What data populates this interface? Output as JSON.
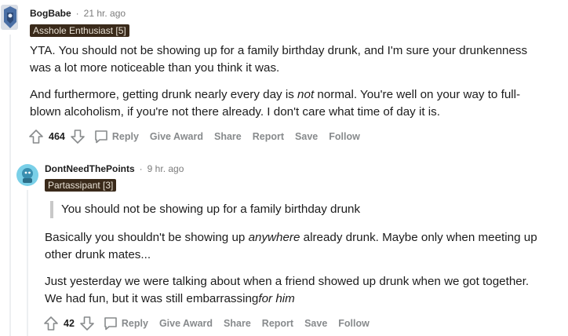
{
  "comments": [
    {
      "username": "BogBabe",
      "dot": "·",
      "time": "21 hr. ago",
      "flair": "Asshole Enthusiast [5]",
      "paragraphs": [
        "YTA. You should not be showing up for a family birthday drunk, and I'm sure your drunkenness",
        "was a lot more noticeable than you think it was."
      ],
      "p2_a": "And furthermore, getting drunk nearly every day is ",
      "p2_em": "not",
      "p2_b": " normal. You're well on your way to full-",
      "p2_line2": "blown alcoholism, if you're not there already. I don't care what time of day it is.",
      "votes": "464",
      "actions": {
        "reply": "Reply",
        "award": "Give Award",
        "share": "Share",
        "report": "Report",
        "save": "Save",
        "follow": "Follow"
      }
    },
    {
      "username": "DontNeedThePoints",
      "dot": "·",
      "time": "9 hr. ago",
      "flair": "Partassipant [3]",
      "quote": "You should not be showing up for a family birthday drunk",
      "p1_a": "Basically you shouldn't be showing up ",
      "p1_em": "anywhere",
      "p1_b": " already drunk. Maybe only when meeting up",
      "p1_line2": "other drunk mates...",
      "p2_line1": "Just yesterday we were talking about when a friend showed up drunk when we got together.",
      "p2_a": "We had fun, but it was still embarrassing",
      "p2_em": "for him",
      "votes": "42",
      "actions": {
        "reply": "Reply",
        "award": "Give Award",
        "share": "Share",
        "report": "Report",
        "save": "Save",
        "follow": "Follow"
      }
    }
  ],
  "colors": {
    "flair_bg": "#3a2a1a",
    "meta_gray": "#7c7c7c",
    "action_gray": "#878a8c"
  }
}
